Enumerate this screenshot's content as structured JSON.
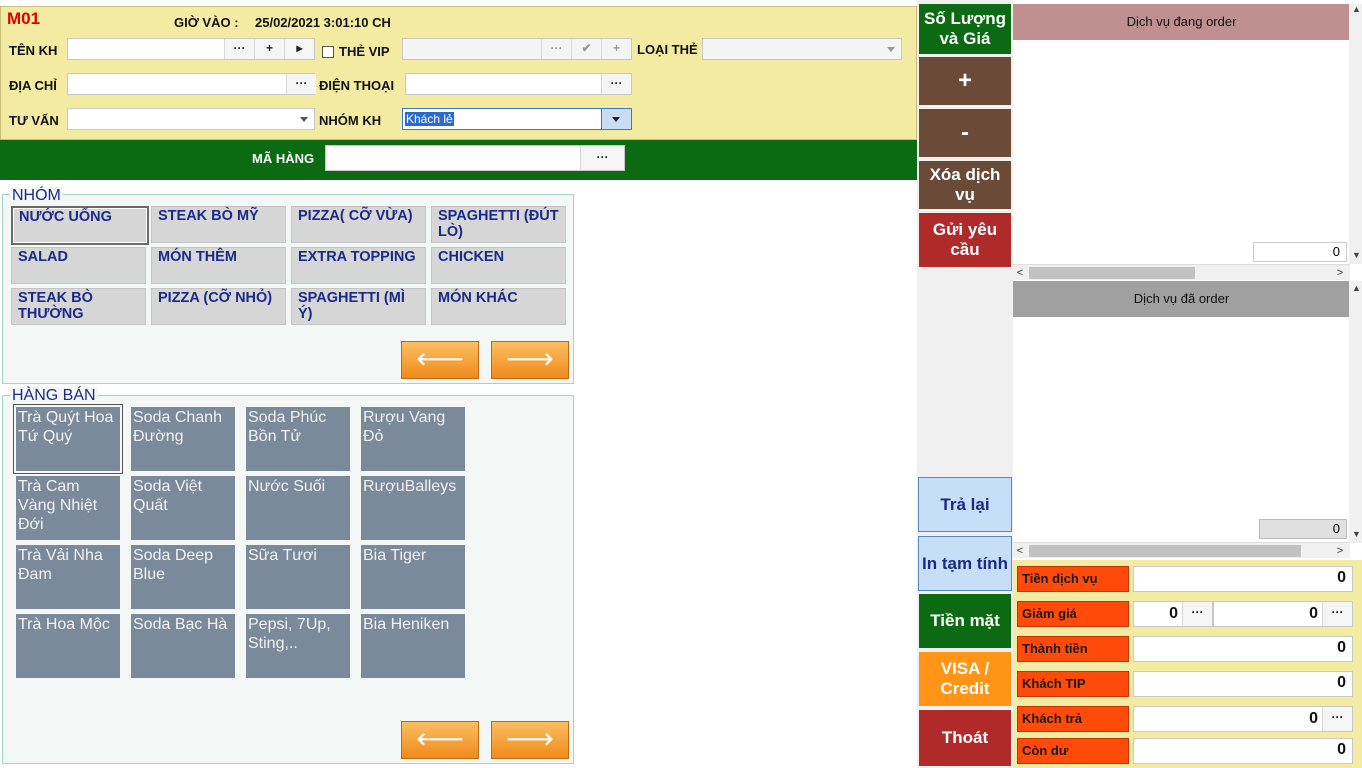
{
  "header": {
    "table_code": "M01",
    "checkin_label": "GIỜ VÀO :",
    "checkin_time": "25/02/2021 3:01:10 CH",
    "customer_name_label": "TÊN KH",
    "vip_label": "THẺ VIP",
    "card_type_label": "LOẠI THẺ",
    "address_label": "ĐỊA CHỈ",
    "phone_label": "ĐIỆN THOẠI",
    "consultant_label": "TƯ VẤN",
    "customer_group_label": "NHÓM KH",
    "customer_group_value": "Khách lẻ",
    "ellipsis": "···",
    "plus": "+",
    "arrow_right": "▸",
    "check": "✔"
  },
  "product_code_label": "MÃ HÀNG",
  "groups": {
    "title": "NHÓM",
    "items": [
      "NƯỚC UỐNG",
      "STEAK BÒ MỸ",
      "PIZZA( CỠ VỪA)",
      "SPAGHETTI (ĐÚT LÒ)",
      "SALAD",
      "MÓN THÊM",
      "EXTRA TOPPING",
      "CHICKEN",
      "STEAK BÒ THƯỜNG",
      "PIZZA (CỠ NHỎ)",
      "SPAGHETTI (MÌ Ý)",
      "MÓN KHÁC"
    ]
  },
  "products": {
    "title": "HÀNG BÁN",
    "items": [
      "Trà Quýt Hoa Tứ Quý",
      "Soda Chanh Đường",
      "Soda Phúc Bồn Tử",
      "Rượu Vang Đỏ",
      "Trà Cam Vàng Nhiệt Đới",
      "Soda Việt Quất",
      "Nước Suối",
      "RượuBalleys",
      "Trà Vải Nha Đam",
      "Soda Deep Blue",
      "Sữa Tươi",
      "Bia Tiger",
      "Trà Hoa Mộc",
      "Soda Bạc Hà",
      "Pepsi, 7Up, Sting,..",
      "Bia Heniken"
    ]
  },
  "nav": {
    "prev": "🡐",
    "next": "🡒"
  },
  "actions": {
    "qty_price": "Số Lượng và Giá",
    "plus": "+",
    "minus": "-",
    "delete_service": "Xóa dịch vụ",
    "send_request": "Gửi yêu cầu",
    "return": "Trả lại",
    "print_temp": "In tạm tính",
    "cash": "Tiền mặt",
    "visa": "VISA / Credit",
    "exit": "Thoát"
  },
  "ordering_panel": {
    "title": "Dịch vụ đang order",
    "count": "0"
  },
  "ordered_panel": {
    "title": "Dịch vụ đã order",
    "count": "0"
  },
  "totals": {
    "service_label": "Tiền dịch vụ",
    "service_value": "0",
    "discount_label": "Giảm giá",
    "discount_value1": "0",
    "discount_value2": "0",
    "total_label": "Thành tiền",
    "total_value": "0",
    "tip_label": "Khách TIP",
    "tip_value": "0",
    "paid_label": "Khách trả",
    "paid_value": "0",
    "change_label": "Còn dư",
    "change_value": "0"
  },
  "colors": {
    "header_bg": "#f3eba2",
    "green": "#0c6b12",
    "brown": "#6b4a38",
    "red": "#b02a2a",
    "orange_btn": "#ff9416",
    "label_orange": "#ff4a0a"
  }
}
